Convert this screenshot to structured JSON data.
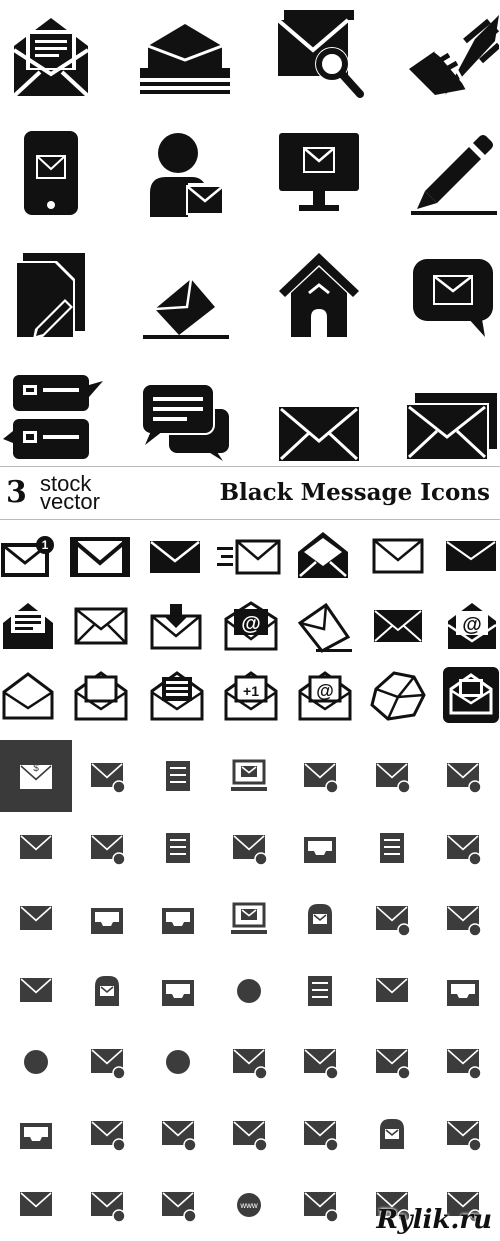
{
  "header": {
    "logo_number": "3",
    "logo_word1": "stock",
    "logo_word2": "vector",
    "title": "Black Message Icons"
  },
  "watermark": "Rylik.ru",
  "badges": {
    "notification_count": "1",
    "plus_one": "+1",
    "at_sign": "@",
    "dollar": "$",
    "www": "www"
  },
  "colors": {
    "icon": "#111111",
    "grey_icon": "#3c3c3c",
    "highlight_bg": "#3a3a3a",
    "background": "#ffffff"
  },
  "large_icons": [
    [
      "open-envelope-letter-icon",
      "envelope-stack-icon",
      "envelope-search-icon",
      "winged-envelope-icon"
    ],
    [
      "phone-mail-icon",
      "user-mail-icon",
      "monitor-mail-icon",
      "pencil-icon"
    ],
    [
      "document-edit-icon",
      "envelope-drop-icon",
      "house-icon",
      "chat-mail-icon"
    ],
    [
      "chat-list-icon",
      "chat-bubbles-icon",
      "envelope-icon",
      "envelope-double-icon"
    ]
  ],
  "small_icons": [
    [
      "envelope-badge-icon",
      "envelope-gmail-icon",
      "envelope-dark-icon",
      "envelope-fast-icon",
      "envelope-open-dark-icon",
      "envelope-outline-icon",
      "envelope-solid-icon"
    ],
    [
      "envelope-open-letter-icon",
      "envelope-outline-icon",
      "envelope-download-icon",
      "envelope-at-icon",
      "envelope-tilted-icon",
      "envelope-solid-icon",
      "envelope-open-at-icon"
    ],
    [
      "envelope-open-outline-icon",
      "envelope-open-paper-icon",
      "envelope-open-letter-icon",
      "envelope-plus-one-icon",
      "envelope-open-at-icon",
      "envelope-crumpled-icon",
      "envelope-highlighted-icon"
    ]
  ],
  "grey_icons": [
    [
      "envelope-dollar-icon",
      "envelope-add-icon",
      "stamp-icon",
      "monitor-mail-icon",
      "envelope-check-icon",
      "envelope-x-icon",
      "envelope-image-icon"
    ],
    [
      "envelope-remove-icon",
      "envelope-down-icon",
      "postcard-icon",
      "envelope-flag-icon",
      "inbox-tray-icon",
      "documents-icon",
      "envelope-music-icon"
    ],
    [
      "envelope-star-icon",
      "inbox-stack-icon",
      "inbox-upload-icon",
      "laptop-mail-icon",
      "mailbox-icon",
      "envelope-block-icon",
      "envelope-alert-icon"
    ],
    [
      "envelope-icon",
      "mailbox-flag-icon",
      "inbox-at-icon",
      "flower-mail-icon",
      "list-mail-icon",
      "envelope-question-icon",
      "inbox-document-icon"
    ],
    [
      "network-mail-icon",
      "envelope-wave-icon",
      "postmark-icon",
      "envelope-at-icon",
      "envelope-open-icon",
      "envelope-share-icon",
      "envelope-lock-icon"
    ],
    [
      "inbox-down-icon",
      "envelope-shield-icon",
      "envelope-minus-icon",
      "envelope-letter-icon",
      "envelope-search-icon",
      "mailbox-post-icon",
      "envelope-zoom-icon"
    ],
    [
      "envelope-forward-icon",
      "envelope-pair-icon",
      "envelope-up-icon",
      "globe-www-icon",
      "envelope-arrow-icon",
      "envelope-speed-icon",
      "envelope-checked-icon"
    ]
  ]
}
